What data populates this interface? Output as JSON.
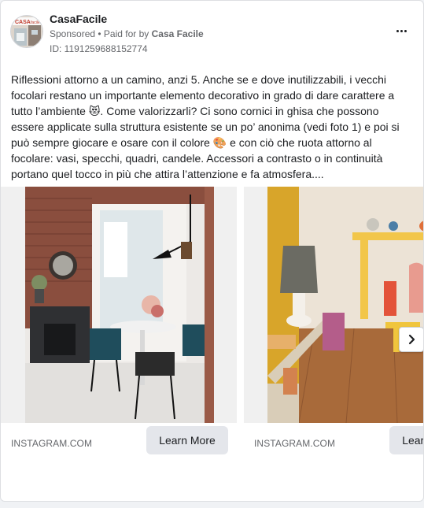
{
  "advertiser": {
    "name": "CasaFacile",
    "avatar_text": "CASA facile"
  },
  "meta": {
    "sponsored": "Sponsored",
    "separator": " • ",
    "paid_for_prefix": "Paid for by ",
    "paid_for_name": "Casa Facile",
    "ad_id": "ID: 1191259688152774"
  },
  "post": {
    "text": "Riflessioni attorno a un camino, anzi 5. Anche se e dove inutilizzabili, i vecchi focolari restano un importante elemento decorativo in grado di dare carattere a tutto l’ambiente 😻. Come valorizzarli? Ci sono cornici in ghisa che possono essere applicate sulla struttura esistente se un po’ anonima (vedi foto 1) e poi si può sempre giocare e osare con il colore 🎨 e con ciò che ruota attorno al focolare: vasi, specchi, quadri, candele. Accessori a contrasto o in continuità portano quel tocco in più che attira l’attenzione e fa atmosfera...."
  },
  "carousel": {
    "cards": [
      {
        "domain": "INSTAGRAM.COM",
        "cta": "Learn More"
      },
      {
        "domain": "INSTAGRAM.COM",
        "cta": "Learn More"
      }
    ],
    "next_icon": "chevron-right-icon"
  },
  "colors": {
    "text_primary": "#1c1e21",
    "text_secondary": "#65676b",
    "button_bg": "#e4e6eb",
    "card_border": "#dddfe2"
  }
}
